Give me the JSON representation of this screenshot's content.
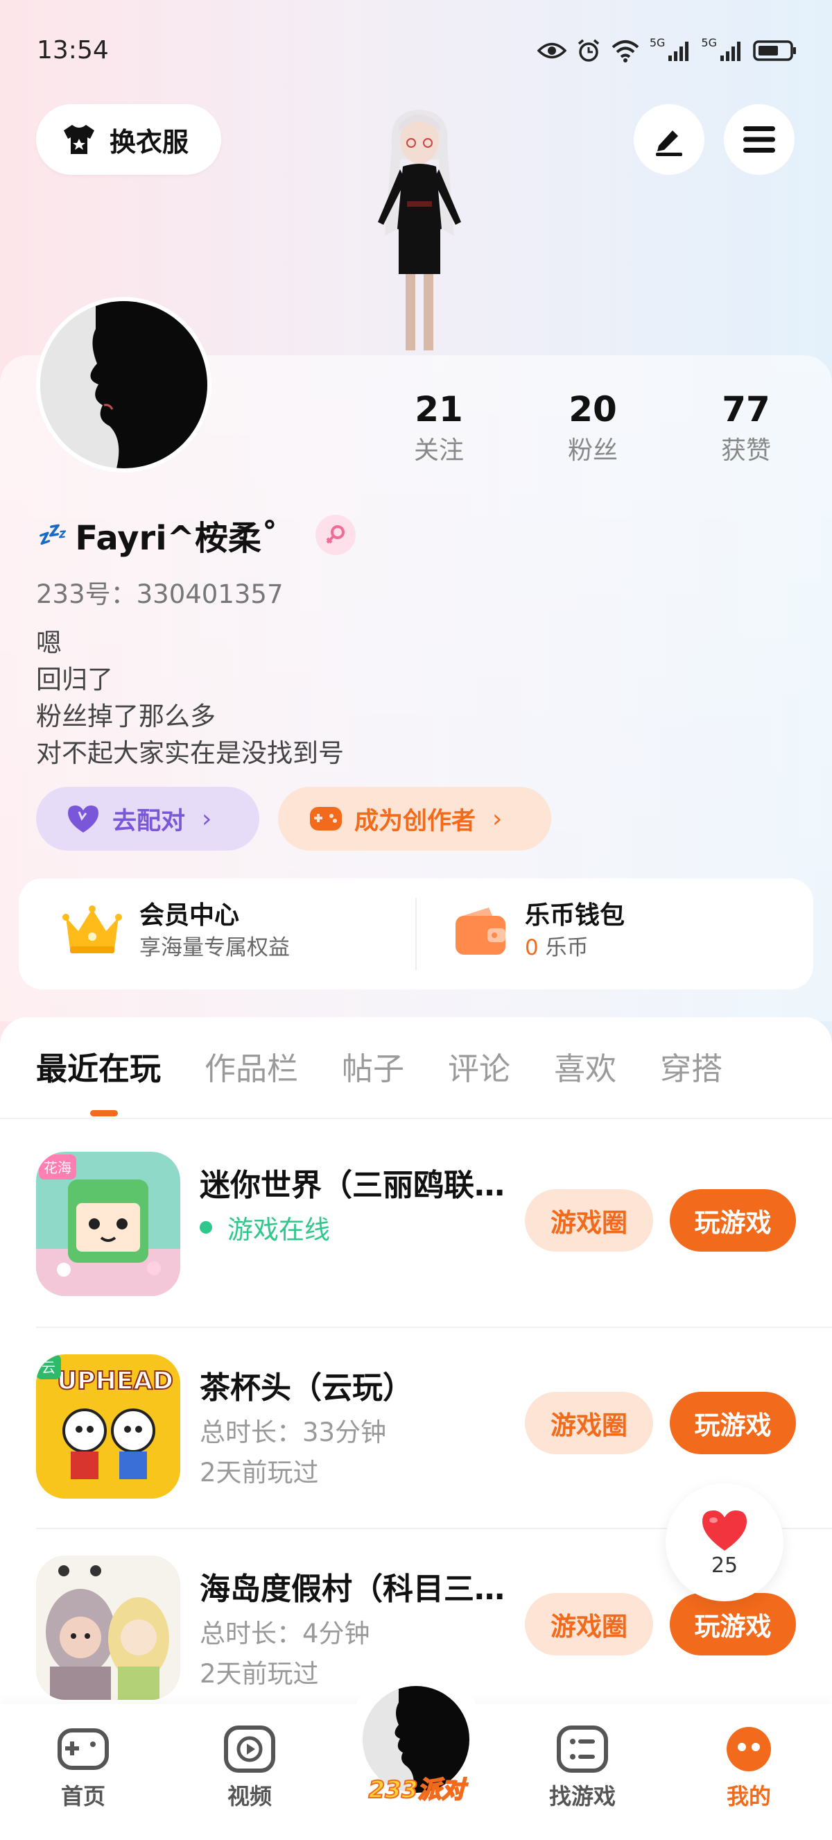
{
  "status_bar": {
    "time": "13:54",
    "signal1": "5G",
    "signal2": "5G"
  },
  "header": {
    "outfit_label": "换衣服"
  },
  "profile": {
    "stats": [
      {
        "num": "21",
        "label": "关注"
      },
      {
        "num": "20",
        "label": "粉丝"
      },
      {
        "num": "77",
        "label": "获赞"
      }
    ],
    "nickname_prefix": "💤",
    "nickname": "Fayri^桉柔˚",
    "uid": "233号：330401357",
    "bio": [
      "嗯",
      "回归了",
      "粉丝掉了那么多",
      "对不起大家实在是没找到号"
    ],
    "match_label": "去配对",
    "creator_label": "成为创作者",
    "chevron": "›"
  },
  "vip": {
    "title": "会员中心",
    "sub": "享海量专属权益",
    "wallet_title": "乐币钱包",
    "wallet_amount": "0",
    "wallet_unit": "乐币"
  },
  "tabs": [
    "最近在玩",
    "作品栏",
    "帖子",
    "评论",
    "喜欢",
    "穿搭"
  ],
  "games": [
    {
      "title": "迷你世界（三丽鸥联…",
      "line1": "游戏在线",
      "line2": "",
      "circle_label": "游戏圈",
      "play_label": "玩游戏"
    },
    {
      "title": "茶杯头（云玩）",
      "line1": "总时长：33分钟",
      "line2": "2天前玩过",
      "circle_label": "游戏圈",
      "play_label": "玩游戏"
    },
    {
      "title": "海岛度假村（科目三…",
      "line1": "总时长：4分钟",
      "line2": "2天前玩过",
      "circle_label": "游戏圈",
      "play_label": "玩游戏"
    }
  ],
  "game_icon_texts": {
    "cloud": "云",
    "cuphead": "UPHEAD",
    "mini": "花海"
  },
  "like_float": {
    "count": "25"
  },
  "bottom_nav": {
    "home": "首页",
    "video": "视频",
    "party": "233派对",
    "find": "找游戏",
    "mine": "我的"
  },
  "colors": {
    "accent": "#f26a1b",
    "purple": "#7a57d8",
    "online": "#2fc78b"
  }
}
